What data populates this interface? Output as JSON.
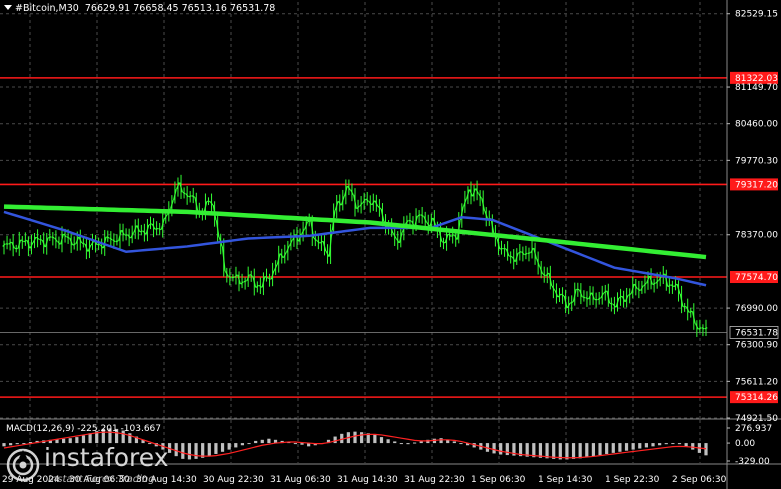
{
  "header": {
    "symbol": "#Bitcoin,M30",
    "open": "76629.91",
    "high": "76658.45",
    "low": "76513.16",
    "close": "76531.78"
  },
  "macd": {
    "label": "MACD(12,26,9) -225.201 -103.667",
    "axis_labels": [
      "276.937",
      "0.00",
      "-329.00"
    ]
  },
  "brand": {
    "name": "instaforex",
    "tagline": "Instant Forex Trading",
    "icon": "bullseye-logo-icon"
  },
  "colors": {
    "background": "#000000",
    "grid": "#4a4a4a",
    "candle": "#33ff33",
    "level": "#ff1a1a",
    "ma_slow": "#33ee33",
    "ma_fast": "#3355dd",
    "ma_mid": "#336699",
    "macd_hist": "#c0c0c0",
    "macd_signal": "#ff2222"
  },
  "chart_data": {
    "type": "candlestick",
    "price_axis": {
      "labels": [
        "82529.15",
        "81149.70",
        "80460.00",
        "79770.30",
        "78370.00",
        "76990.00",
        "76300.90",
        "75611.20",
        "74921.50"
      ],
      "ylim": [
        74921.5,
        82750
      ]
    },
    "current_price": "76531.78",
    "levels": [
      {
        "label": "81322.03",
        "value": 81322.03
      },
      {
        "label": "79317.20",
        "value": 79317.2
      },
      {
        "label": "77574.70",
        "value": 77574.7
      },
      {
        "label": "75314.26",
        "value": 75314.26
      }
    ],
    "time_labels": [
      "29 Aug 2024",
      "30 Aug 06:30",
      "30 Aug 14:30",
      "30 Aug 22:30",
      "31 Aug 06:30",
      "31 Aug 14:30",
      "31 Aug 22:30",
      "1 Sep 06:30",
      "1 Sep 14:30",
      "1 Sep 22:30",
      "2 Sep 06:30"
    ],
    "close_path": [
      [
        0,
        78150
      ],
      [
        5,
        78250
      ],
      [
        10,
        78300
      ],
      [
        14,
        78150
      ],
      [
        18,
        78300
      ],
      [
        22,
        78450
      ],
      [
        26,
        78550
      ],
      [
        28,
        79250
      ],
      [
        30,
        79150
      ],
      [
        32,
        78800
      ],
      [
        34,
        79000
      ],
      [
        36,
        77700
      ],
      [
        38,
        77500
      ],
      [
        40,
        77550
      ],
      [
        42,
        77400
      ],
      [
        44,
        77700
      ],
      [
        46,
        78100
      ],
      [
        48,
        78350
      ],
      [
        50,
        78600
      ],
      [
        51,
        78250
      ],
      [
        53,
        78050
      ],
      [
        54,
        78800
      ],
      [
        56,
        79250
      ],
      [
        58,
        78900
      ],
      [
        60,
        79050
      ],
      [
        62,
        78700
      ],
      [
        64,
        78250
      ],
      [
        66,
        78600
      ],
      [
        68,
        78700
      ],
      [
        70,
        78600
      ],
      [
        72,
        78250
      ],
      [
        74,
        78400
      ],
      [
        76,
        79250
      ],
      [
        78,
        79050
      ],
      [
        80,
        78400
      ],
      [
        82,
        78000
      ],
      [
        84,
        77950
      ],
      [
        86,
        78100
      ],
      [
        88,
        77700
      ],
      [
        90,
        77350
      ],
      [
        92,
        77050
      ],
      [
        94,
        77300
      ],
      [
        96,
        77150
      ],
      [
        98,
        77250
      ],
      [
        100,
        77050
      ],
      [
        102,
        77250
      ],
      [
        104,
        77400
      ],
      [
        106,
        77500
      ],
      [
        108,
        77550
      ],
      [
        110,
        77350
      ],
      [
        112,
        76900
      ],
      [
        114,
        76600
      ],
      [
        115,
        76532
      ]
    ],
    "ma_slow": [
      [
        0,
        78900
      ],
      [
        30,
        78800
      ],
      [
        60,
        78600
      ],
      [
        90,
        78250
      ],
      [
        115,
        77950
      ]
    ],
    "ma_fast": [
      [
        0,
        78800
      ],
      [
        10,
        78450
      ],
      [
        20,
        78050
      ],
      [
        30,
        78150
      ],
      [
        40,
        78300
      ],
      [
        50,
        78350
      ],
      [
        60,
        78500
      ],
      [
        70,
        78500
      ],
      [
        75,
        78700
      ],
      [
        80,
        78650
      ],
      [
        90,
        78200
      ],
      [
        100,
        77750
      ],
      [
        110,
        77550
      ],
      [
        115,
        77420
      ]
    ],
    "macd_hist": [
      -60,
      -40,
      -20,
      0,
      20,
      40,
      50,
      60,
      70,
      80,
      90,
      110,
      140,
      180,
      220,
      260,
      270,
      260,
      230,
      180,
      120,
      60,
      0,
      -60,
      -120,
      -180,
      -240,
      -290,
      -300,
      -290,
      -270,
      -240,
      -200,
      -160,
      -120,
      -80,
      -40,
      0,
      40,
      60,
      80,
      60,
      40,
      20,
      0,
      -30,
      -60,
      -40,
      0,
      60,
      120,
      170,
      200,
      210,
      200,
      180,
      150,
      110,
      70,
      30,
      0,
      -20,
      10,
      30,
      60,
      80,
      90,
      60,
      30,
      0,
      -40,
      -80,
      -120,
      -160,
      -190,
      -210,
      -220,
      -230,
      -240,
      -250,
      -260,
      -270,
      -280,
      -290,
      -300,
      -300,
      -290,
      -280,
      -260,
      -240,
      -220,
      -200,
      -180,
      -160,
      -140,
      -120,
      -100,
      -80,
      -60,
      -40,
      -20,
      0,
      -20,
      -60,
      -120,
      -180,
      -225
    ],
    "macd_signal": [
      -90,
      -70,
      -50,
      -30,
      -10,
      10,
      30,
      50,
      70,
      90,
      110,
      130,
      150,
      170,
      190,
      200,
      200,
      190,
      170,
      140,
      100,
      60,
      20,
      -20,
      -60,
      -100,
      -140,
      -180,
      -210,
      -230,
      -240,
      -240,
      -230,
      -210,
      -190,
      -160,
      -130,
      -100,
      -70,
      -40,
      -20,
      0,
      10,
      20,
      20,
      10,
      0,
      -10,
      -10,
      10,
      40,
      70,
      100,
      130,
      150,
      160,
      160,
      150,
      130,
      110,
      90,
      70,
      50,
      40,
      40,
      50,
      60,
      60,
      50,
      30,
      0,
      -30,
      -60,
      -90,
      -120,
      -150,
      -170,
      -190,
      -210,
      -220,
      -230,
      -240,
      -250,
      -260,
      -265,
      -270,
      -270,
      -265,
      -255,
      -245,
      -230,
      -215,
      -200,
      -185,
      -170,
      -155,
      -140,
      -125,
      -110,
      -95,
      -80,
      -65,
      -60,
      -65,
      -75,
      -90,
      -104
    ]
  }
}
